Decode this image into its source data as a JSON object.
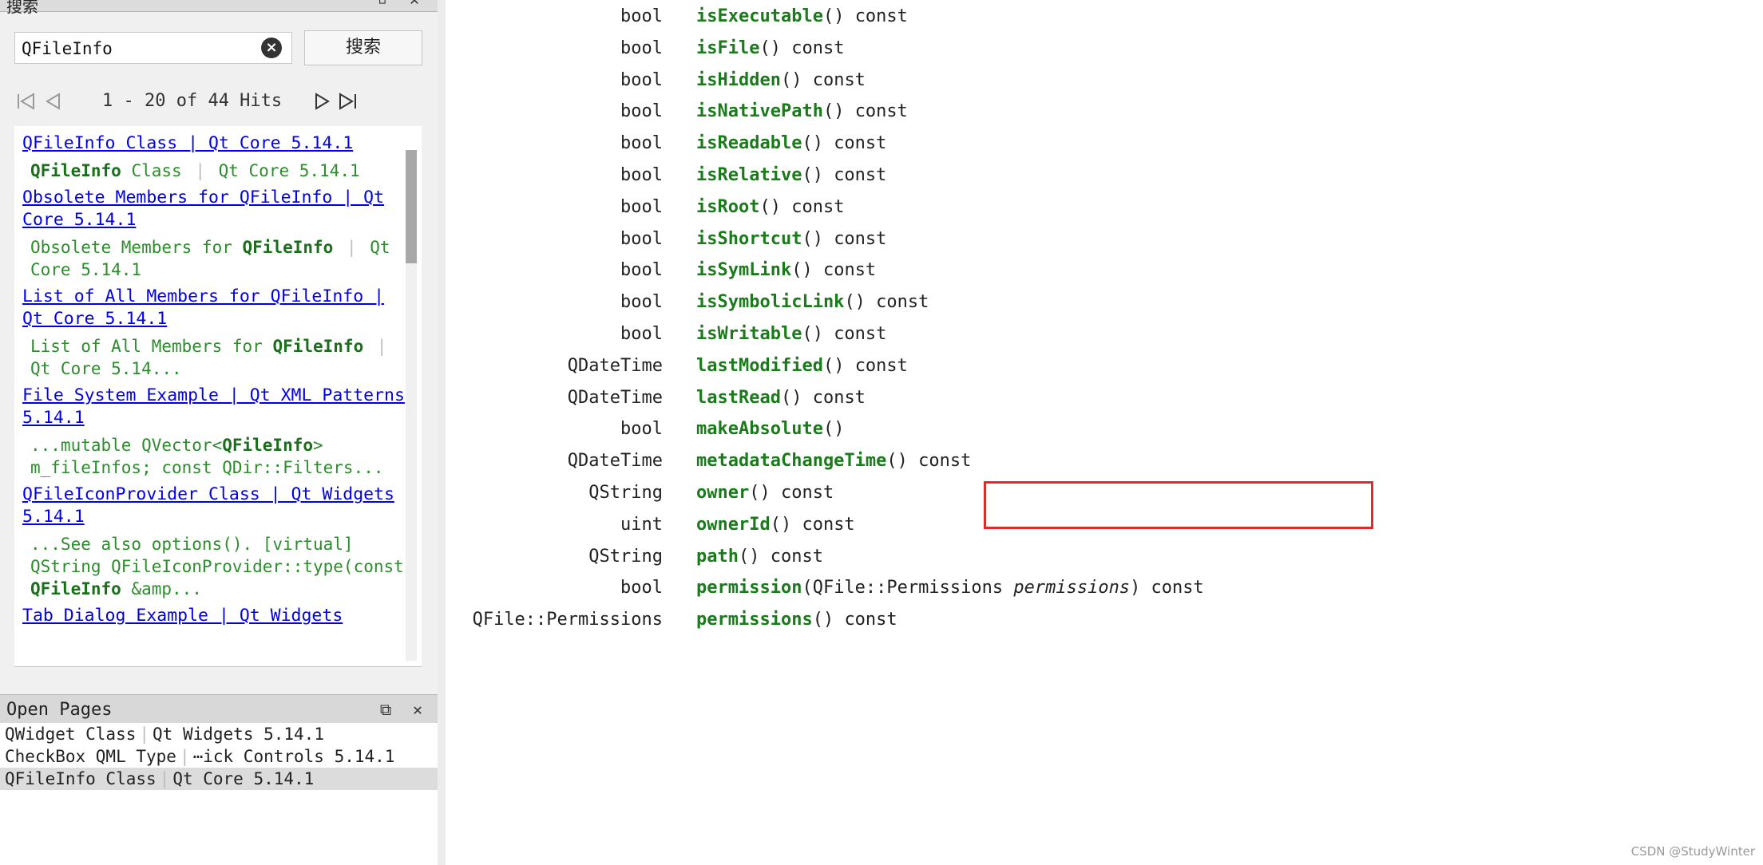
{
  "search_dock": {
    "title": "搜索"
  },
  "search": {
    "value": "QFileInfo",
    "button_label": "搜索"
  },
  "pager": {
    "hits_text": "1 - 20 of 44 Hits"
  },
  "results": [
    {
      "link": "QFileInfo Class | Qt Core 5.14.1",
      "snippet_html": "<b>QFileInfo</b> Class <span class='sep'>|</span> Qt Core 5.14.1"
    },
    {
      "link": "Obsolete Members for QFileInfo | Qt Core 5.14.1",
      "snippet_html": "Obsolete Members for <b>QFileInfo</b> <span class='sep'>|</span> Qt Core 5.14.1"
    },
    {
      "link": "List of All Members for QFileInfo | Qt Core 5.14.1",
      "snippet_html": "List of All Members for <b>QFileInfo</b> <span class='sep'>|</span> Qt Core 5.14..."
    },
    {
      "link": "File System Example | Qt XML Patterns 5.14.1",
      "snippet_html": "...mutable QVector&lt;<b>QFileInfo</b>&gt; m_fileInfos; const QDir::Filters..."
    },
    {
      "link": "QFileIconProvider Class | Qt Widgets 5.14.1",
      "snippet_html": "...See also options(). [virtual] QString QFileIconProvider::type(const <b>QFileInfo</b> &amp;amp..."
    },
    {
      "link": "Tab Dialog Example | Qt Widgets",
      "snippet_html": ""
    }
  ],
  "open_pages": {
    "title": "Open Pages",
    "items": [
      {
        "left": "QWidget Class",
        "right": "Qt Widgets 5.14.1",
        "selected": false
      },
      {
        "left": "CheckBox QML Type",
        "right": "⋯ick Controls 5.14.1",
        "selected": false
      },
      {
        "left": "QFileInfo Class",
        "right": "Qt Core 5.14.1",
        "selected": true
      }
    ]
  },
  "members": [
    {
      "type": "bool",
      "name": "isExecutable",
      "args": "() const"
    },
    {
      "type": "bool",
      "name": "isFile",
      "args": "() const"
    },
    {
      "type": "bool",
      "name": "isHidden",
      "args": "() const"
    },
    {
      "type": "bool",
      "name": "isNativePath",
      "args": "() const"
    },
    {
      "type": "bool",
      "name": "isReadable",
      "args": "() const"
    },
    {
      "type": "bool",
      "name": "isRelative",
      "args": "() const"
    },
    {
      "type": "bool",
      "name": "isRoot",
      "args": "() const"
    },
    {
      "type": "bool",
      "name": "isShortcut",
      "args": "() const"
    },
    {
      "type": "bool",
      "name": "isSymLink",
      "args": "() const"
    },
    {
      "type": "bool",
      "name": "isSymbolicLink",
      "args": "() const"
    },
    {
      "type": "bool",
      "name": "isWritable",
      "args": "() const"
    },
    {
      "type": "QDateTime",
      "name": "lastModified",
      "args": "() const",
      "highlighted": true
    },
    {
      "type": "QDateTime",
      "name": "lastRead",
      "args": "() const"
    },
    {
      "type": "bool",
      "name": "makeAbsolute",
      "args": "()"
    },
    {
      "type": "QDateTime",
      "name": "metadataChangeTime",
      "args": "() const"
    },
    {
      "type": "QString",
      "name": "owner",
      "args": "() const"
    },
    {
      "type": "uint",
      "name": "ownerId",
      "args": "() const"
    },
    {
      "type": "QString",
      "name": "path",
      "args": "() const"
    },
    {
      "type": "bool",
      "name": "permission",
      "args_pre": "(QFile::Permissions ",
      "param": "permissions",
      "args_post": ") const"
    },
    {
      "type": "QFile::Permissions",
      "name": "permissions",
      "args": "() const"
    }
  ],
  "watermark": "CSDN @StudyWinter",
  "colors": {
    "highlight_border": "#e02a2a",
    "member_name": "#1b7a1b",
    "link": "#0000ee",
    "snippet": "#2e8b2e"
  }
}
